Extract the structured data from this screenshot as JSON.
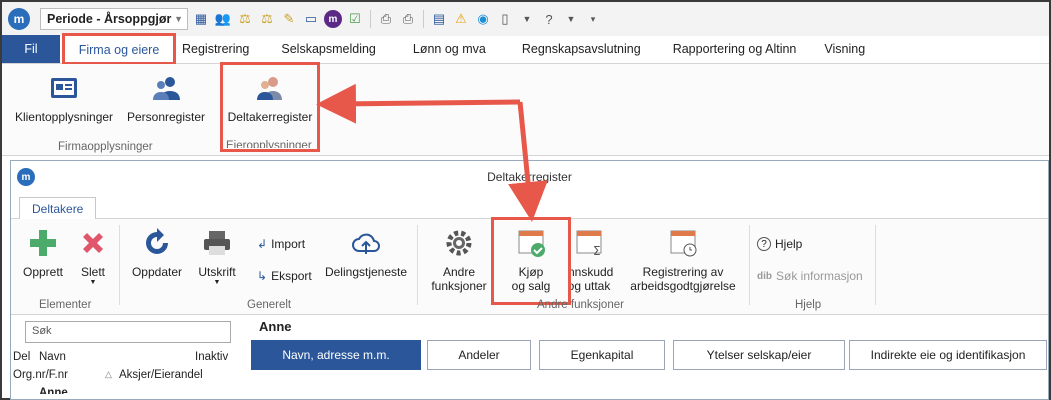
{
  "app": {
    "logo_letter": "m"
  },
  "qat": {
    "period_value": "Periode - Årsoppgjør",
    "icons": [
      "calc-icon",
      "users-icon",
      "scale-icon",
      "scale2-icon",
      "edit-icon",
      "presentation-icon",
      "m-badge-icon",
      "check-icon",
      "print-icon",
      "print-check-icon",
      "grid-icon",
      "warning-icon",
      "skype-icon",
      "document-icon",
      "help-icon"
    ]
  },
  "ribbon_tabs": [
    "Fil",
    "Firma og eiere",
    "Registrering",
    "Selskapsmelding",
    "Lønn og mva",
    "Regnskapsavslutning",
    "Rapportering og Altinn",
    "Visning"
  ],
  "ribbon": {
    "klient": "Klientopplysninger",
    "person": "Personregister",
    "deltaker": "Deltakerregister",
    "group_firma": "Firmaopplysninger",
    "group_eier": "Eieropplysninger"
  },
  "child": {
    "title": "Deltakerregister",
    "tab": "Deltakere",
    "buttons": {
      "opprett": "Opprett",
      "slett": "Slett",
      "oppdater": "Oppdater",
      "utskrift": "Utskrift",
      "import": "Import",
      "eksport": "Eksport",
      "delingstjeneste": "Delingstjeneste",
      "andre_line1": "Andre",
      "andre_line2": "funksjoner",
      "kjop_line1": "Kjøp",
      "kjop_line2": "og salg",
      "innskudd_line1": "Innskudd",
      "innskudd_line2": "og uttak",
      "reg_line1": "Registrering av",
      "reg_line2": "arbeidsgodtgjørelse",
      "hjelp": "Hjelp",
      "sok": "Søk informasjon"
    },
    "groups": {
      "elementer": "Elementer",
      "generelt": "Generelt",
      "andre": "Andre funksjoner",
      "hjelp": "Hjelp"
    },
    "search_placeholder": "Søk",
    "list": {
      "col_del": "Del",
      "col_navn": "Navn",
      "col_inaktiv": "Inaktiv",
      "col_org": "Org.nr/F.nr",
      "col_aksjer": "Aksjer/Eierandel",
      "row_partial": "Anne"
    },
    "person": "Anne",
    "sub_tabs": [
      "Navn, adresse m.m.",
      "Andeler",
      "Egenkapital",
      "Ytelser selskap/eier",
      "Indirekte eie og identifikasjon"
    ]
  },
  "colors": {
    "accent": "#2b579a",
    "highlight": "#e8584a"
  }
}
